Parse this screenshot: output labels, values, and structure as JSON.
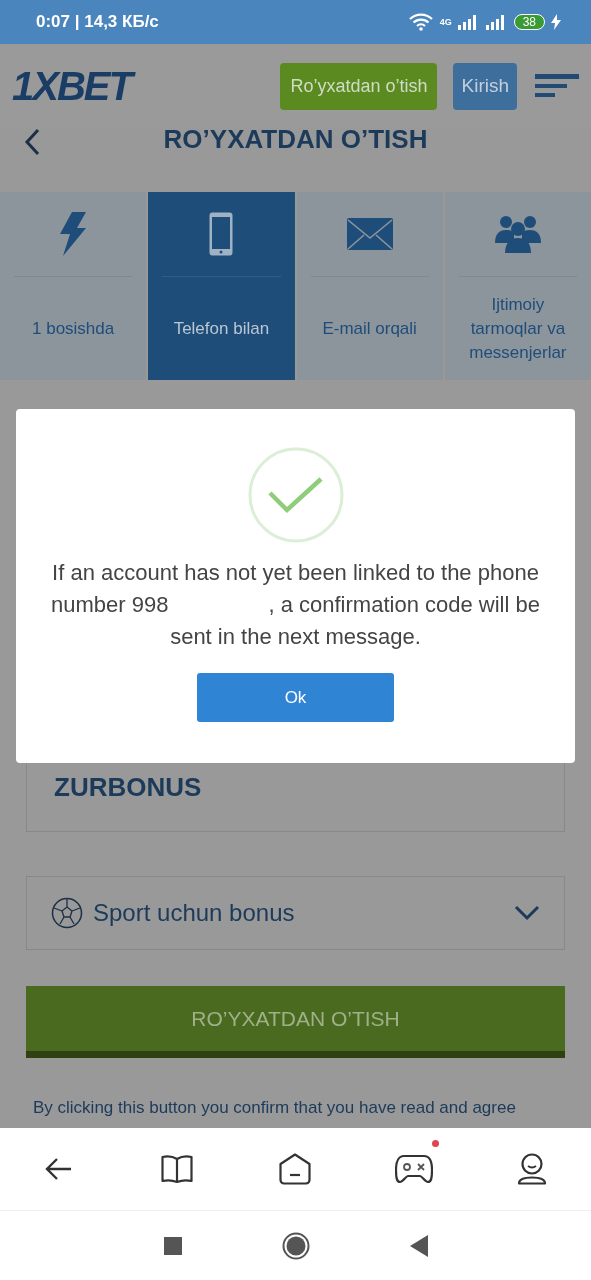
{
  "status_bar": {
    "time": "0:07 | 14,3 КБ/с",
    "network": "4G",
    "battery": "38"
  },
  "header": {
    "logo": "1XBET",
    "register_button": "Ro’yxatdan o’tish",
    "login_button": "Kirish"
  },
  "page_title": "RO’YXATDAN O’TISH",
  "tabs": [
    {
      "kind": "bolt",
      "label": "1 bosishda",
      "selected": false
    },
    {
      "kind": "phone",
      "label": "Telefon bilan",
      "selected": true
    },
    {
      "kind": "mail",
      "label": "E-mail orqali",
      "selected": false
    },
    {
      "kind": "people",
      "label": "Ijtimoiy tarmoqlar va messenjerlar",
      "selected": false
    }
  ],
  "promo_field": {
    "value": "ZURBONUS"
  },
  "bonus_select": {
    "value": "Sport uchun bonus"
  },
  "submit_button": "RO’YXATDAN O’TISH",
  "terms_text": "By clicking this button you confirm that you have read and agree",
  "dialog": {
    "message_before": "If an account has not yet been linked to the phone number 998",
    "message_after": ", a confirmation code will be sent in the next message.",
    "ok_button": "Ok"
  },
  "bottom_nav": [
    {
      "kind": "back",
      "dot": false
    },
    {
      "kind": "book",
      "dot": false
    },
    {
      "kind": "home",
      "dot": false
    },
    {
      "kind": "gamepad",
      "dot": true
    },
    {
      "kind": "profile",
      "dot": false
    }
  ]
}
